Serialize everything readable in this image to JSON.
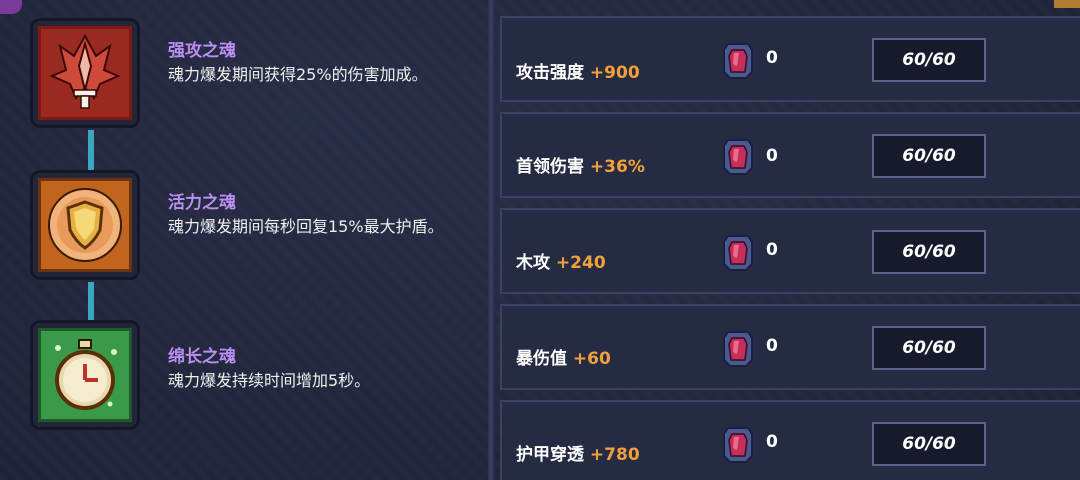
{
  "souls": [
    {
      "title": "强攻之魂",
      "desc": "魂力爆发期间获得25%的伤害加成。",
      "icon": "red-sword-emblem-icon",
      "color": "#b3302a"
    },
    {
      "title": "活力之魂",
      "desc": "魂力爆发期间每秒回复15%最大护盾。",
      "icon": "golden-shield-emblem-icon",
      "color": "#d08a3a"
    },
    {
      "title": "绵长之魂",
      "desc": "魂力爆发持续时间增加5秒。",
      "icon": "green-stopwatch-emblem-icon",
      "color": "#4fae5a"
    }
  ],
  "stats": [
    {
      "name": "攻击强度",
      "bonus": "+900",
      "gems": "0",
      "level": "60/60"
    },
    {
      "name": "首领伤害",
      "bonus": "+36%",
      "gems": "0",
      "level": "60/60"
    },
    {
      "name": "木攻",
      "bonus": "+240",
      "gems": "0",
      "level": "60/60"
    },
    {
      "name": "暴伤值",
      "bonus": "+60",
      "gems": "0",
      "level": "60/60"
    },
    {
      "name": "护甲穿透",
      "bonus": "+780",
      "gems": "0",
      "level": "60/60"
    }
  ],
  "colors": {
    "accent_bonus": "#f2a13a",
    "title_purple": "#b98ff0",
    "gem": "#c2305a"
  }
}
